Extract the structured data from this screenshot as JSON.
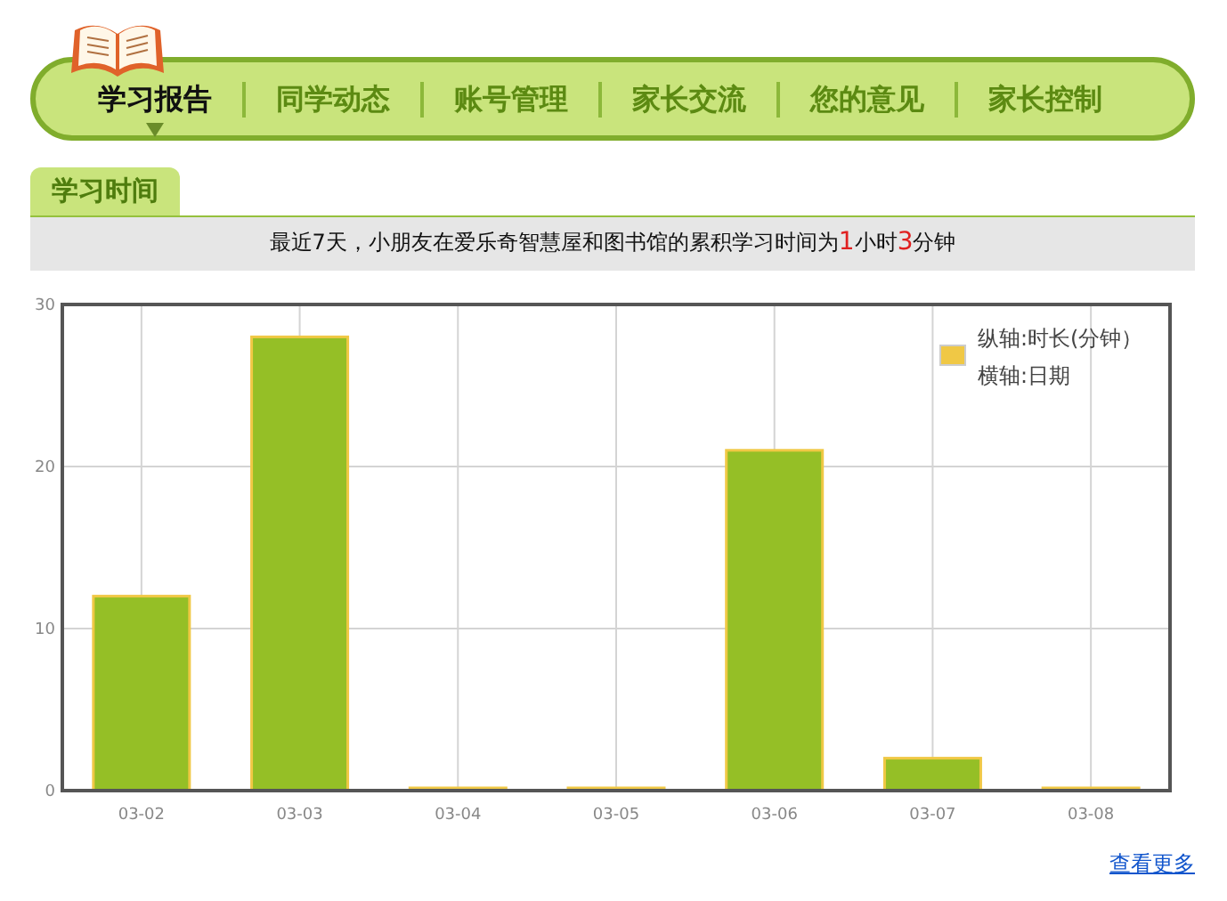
{
  "nav": {
    "tabs": [
      {
        "label": "学习报告",
        "selected": true
      },
      {
        "label": "同学动态",
        "selected": false
      },
      {
        "label": "账号管理",
        "selected": false
      },
      {
        "label": "家长交流",
        "selected": false
      },
      {
        "label": "您的意见",
        "selected": false
      },
      {
        "label": "家长控制",
        "selected": false
      }
    ]
  },
  "section": {
    "title": "学习时间",
    "summary": [
      {
        "text": "最近7天，小朋友在爱乐奇智慧屋和图书馆的累积学习时间为",
        "highlight": false
      },
      {
        "text": "1",
        "highlight": true
      },
      {
        "text": "小时",
        "highlight": false
      },
      {
        "text": "3",
        "highlight": true
      },
      {
        "text": "分钟",
        "highlight": false
      }
    ],
    "chart_data": {
      "type": "bar",
      "categories": [
        "03-02",
        "03-03",
        "03-04",
        "03-05",
        "03-06",
        "03-07",
        "03-08"
      ],
      "series": [
        {
          "name": "纵轴:时长(分钟）",
          "color": "#f0c845",
          "values": [
            12,
            28,
            0,
            0,
            21,
            2,
            0
          ]
        }
      ],
      "xlabel": "横轴:日期",
      "grid": true,
      "ylim": [
        0,
        30
      ],
      "yticks": [
        0,
        10,
        20,
        30
      ]
    },
    "more_link": "查看更多"
  }
}
